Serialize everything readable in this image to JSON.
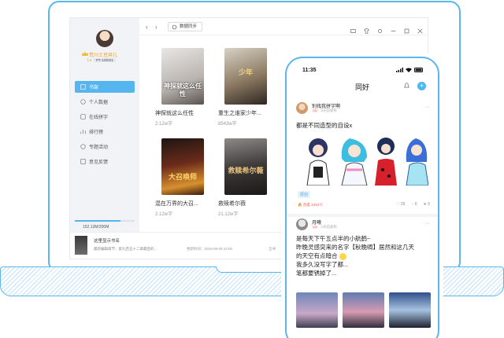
{
  "app": {
    "toolbar": {
      "sync_label": "数据同步"
    },
    "user": {
      "name": "荒川土豆井儿",
      "id": "PT 120021",
      "level": "Lv"
    },
    "sidebar": {
      "items": [
        {
          "label": "书架",
          "icon": "bookshelf-icon",
          "active": true
        },
        {
          "label": "个人数据",
          "icon": "chart-icon"
        },
        {
          "label": "在线拼字",
          "icon": "edit-icon"
        },
        {
          "label": "排行榜",
          "icon": "ranking-icon"
        },
        {
          "label": "专题活动",
          "icon": "activity-icon"
        },
        {
          "label": "意见反馈",
          "icon": "feedback-icon"
        }
      ],
      "storage_text": "152.12M/200M",
      "storage_fraction": 0.76
    },
    "books": [
      {
        "title": "神探就这么任性",
        "words": "2.12w字",
        "cover_text": "神探就这么任性"
      },
      {
        "title": "重生之谁家少年...",
        "words": "8543w字",
        "cover_text": "少年"
      },
      {
        "title": "混在万界的大召...",
        "words": "2.12w字",
        "cover_text": "大召唤师"
      },
      {
        "title": "救赎希尔薇",
        "words": "21.12w字",
        "cover_text": "救赎希尔薇"
      }
    ],
    "player": {
      "title": "这里显示书名",
      "subtitle": "最新编辑章节：第九百五十二章最后的...",
      "time": "更新时间：2018-08-08 22:00",
      "more": "全书"
    }
  },
  "phone": {
    "status_time": "11:35",
    "title": "同好",
    "post1": {
      "name": "别找我拼字啊",
      "level": "LV",
      "meta": "3天前发布",
      "text": "都是不同造型的自设x",
      "tag": "原创",
      "hot": "热度 2493℃",
      "likes": "25",
      "comments": "6",
      "shares": "5"
    },
    "post2": {
      "name": "月曦",
      "level": "LV",
      "meta": "2天前发布",
      "lines": [
        "是每天下午五点半的小航鹤~",
        "昨晚灵感突来的名字【秋晚啁】居然和这几天",
        "的天空有点暗合",
        "我多久没写字了都...",
        "笔都要锈掉了..."
      ]
    }
  }
}
